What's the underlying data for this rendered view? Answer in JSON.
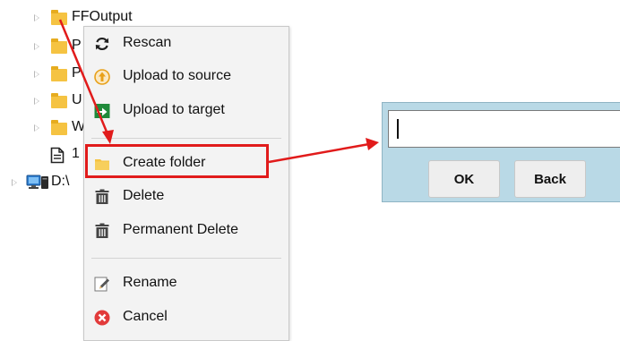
{
  "tree": {
    "root_folder_label": "FFOutput",
    "partial_labels": [
      "P",
      "P",
      "U",
      "W",
      "1"
    ],
    "drive_label": "D:\\"
  },
  "context_menu": {
    "items": [
      {
        "label": "Rescan",
        "icon": "refresh-icon"
      },
      {
        "label": "Upload to source",
        "icon": "upload-up-arrow-icon"
      },
      {
        "label": "Upload to target",
        "icon": "upload-target-icon"
      },
      {
        "label": "Create folder",
        "icon": "folder-icon"
      },
      {
        "label": "Delete",
        "icon": "trash-icon"
      },
      {
        "label": "Permanent Delete",
        "icon": "trash-icon"
      },
      {
        "label": "Rename",
        "icon": "pencil-icon"
      },
      {
        "label": "Cancel",
        "icon": "cancel-icon"
      }
    ]
  },
  "dialog": {
    "input_value": "",
    "ok_label": "OK",
    "back_label": "Back"
  },
  "colors": {
    "highlight": "#e11b1b",
    "dialog_bg": "#b9d9e6",
    "folder": "#f5c342",
    "menu_bg": "#f3f3f3"
  }
}
